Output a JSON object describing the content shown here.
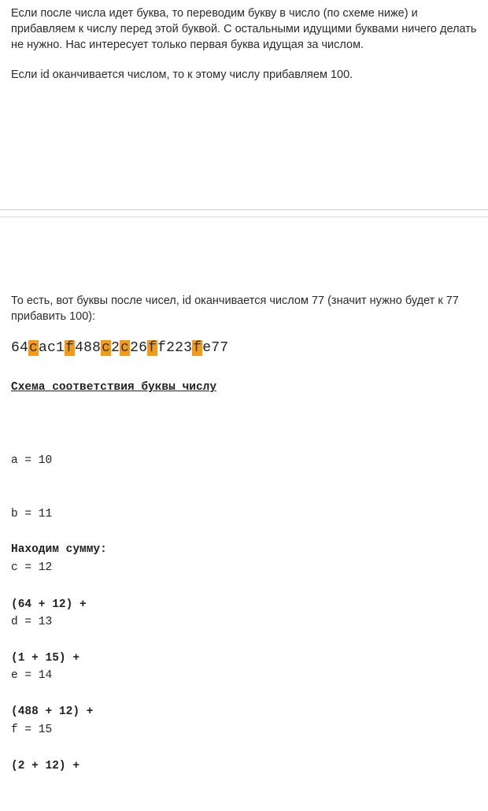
{
  "paragraphs": {
    "p1": "Если после числа идет буква, то переводим букву в число (по схеме ниже) и прибавляем к числу перед этой буквой. С остальными идущими буквами ничего делать не нужно. Нас интересует только первая буква идущая за числом.",
    "p2": "Если id оканчивается числом, то к этому числу прибавляем 100.",
    "p3": "То есть, вот буквы после чисел, id оканчивается числом 77 (значит нужно будет к 77 прибавить 100):"
  },
  "id_string": {
    "highlight_color": "#f59a14",
    "segments": [
      {
        "text": "64",
        "highlight": false
      },
      {
        "text": "c",
        "highlight": true
      },
      {
        "text": "ac",
        "highlight": false
      },
      {
        "text": "1",
        "highlight": false
      },
      {
        "text": "f",
        "highlight": true
      },
      {
        "text": "488",
        "highlight": false
      },
      {
        "text": "c",
        "highlight": true
      },
      {
        "text": "2",
        "highlight": false
      },
      {
        "text": "c",
        "highlight": true
      },
      {
        "text": "26",
        "highlight": false
      },
      {
        "text": "f",
        "highlight": true
      },
      {
        "text": "f223",
        "highlight": false
      },
      {
        "text": "f",
        "highlight": true
      },
      {
        "text": "e77",
        "highlight": false
      }
    ]
  },
  "scheme": {
    "title": "Схема соответствия буквы числу",
    "items": [
      "a = 10",
      "b = 11",
      "c = 12",
      "d = 13",
      "e = 14",
      "f = 15"
    ]
  },
  "sum": {
    "title": "Находим сумму:",
    "lines": [
      "(64 + 12) +",
      "(1 + 15) +",
      "(488 + 12) +",
      "(2 + 12) +"
    ]
  }
}
